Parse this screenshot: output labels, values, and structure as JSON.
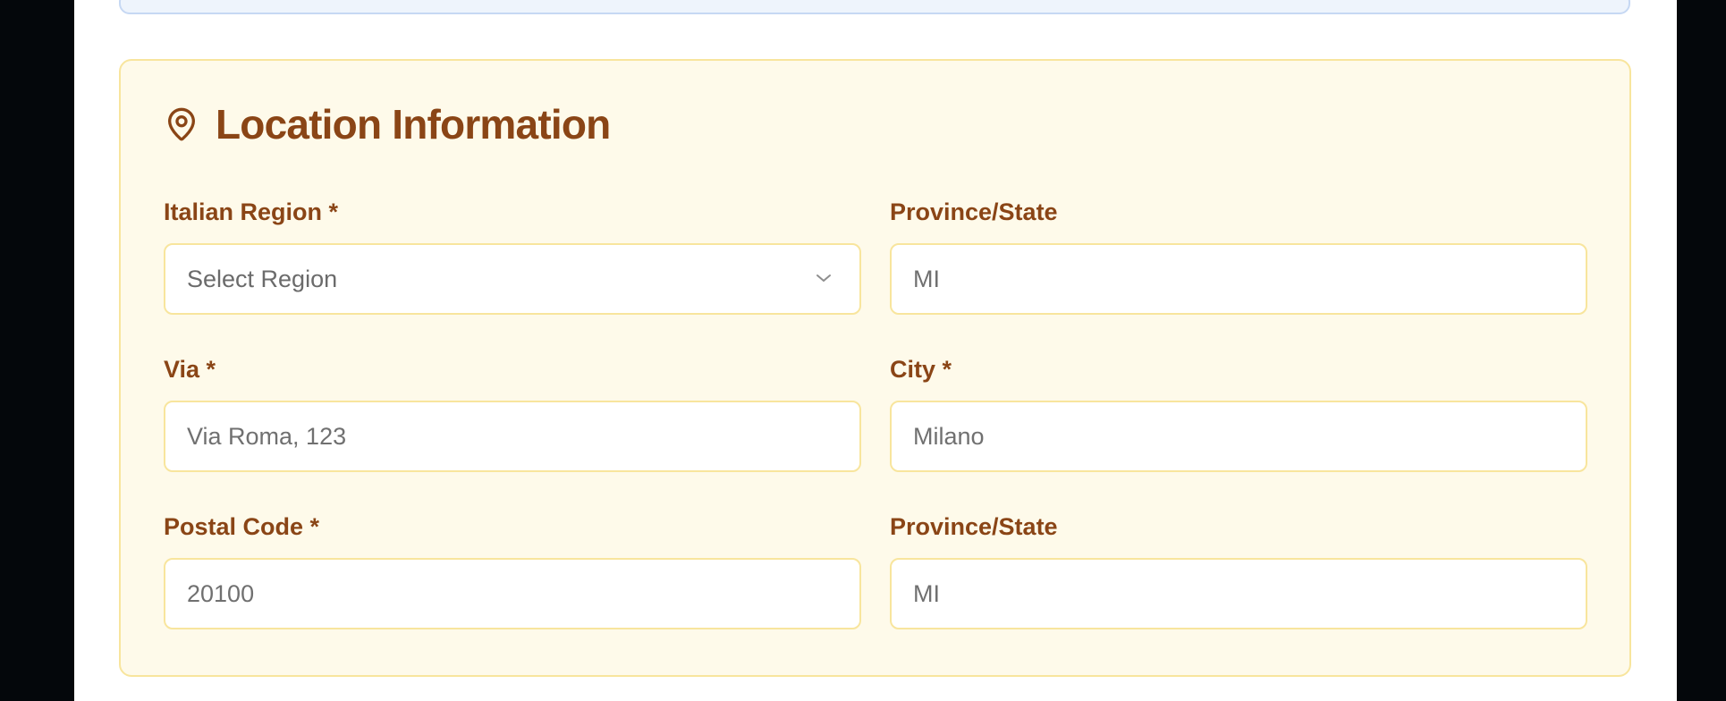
{
  "section": {
    "title": "Location Information",
    "icon": "map-pin-icon"
  },
  "colors": {
    "accent_text": "#8a4516",
    "card_background": "#fefaea",
    "card_border": "#f8e59d",
    "page_background": "#ffffff",
    "outer_background": "#04070b"
  },
  "fields": {
    "region": {
      "label": "Italian Region *",
      "selected": "Select Region"
    },
    "province_top": {
      "label": "Province/State",
      "placeholder": "MI"
    },
    "via": {
      "label": "Via *",
      "placeholder": "Via Roma, 123"
    },
    "city": {
      "label": "City *",
      "placeholder": "Milano"
    },
    "postal_code": {
      "label": "Postal Code *",
      "placeholder": "20100"
    },
    "province_bottom": {
      "label": "Province/State",
      "placeholder": "MI"
    }
  }
}
